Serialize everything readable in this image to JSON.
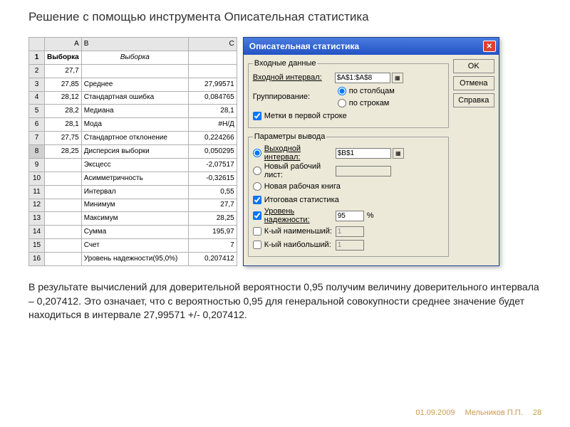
{
  "title": "Решение с помощью инструмента Описательная статистика",
  "sheet": {
    "cols": [
      "A",
      "B",
      "C"
    ],
    "rows": [
      {
        "n": "1",
        "a": "Выборка",
        "b": "Выборка",
        "c": ""
      },
      {
        "n": "2",
        "a": "27,7",
        "b": "",
        "c": ""
      },
      {
        "n": "3",
        "a": "27,85",
        "b": "Среднее",
        "c": "27,99571"
      },
      {
        "n": "4",
        "a": "28,12",
        "b": "Стандартная ошибка",
        "c": "0,084765"
      },
      {
        "n": "5",
        "a": "28,2",
        "b": "Медиана",
        "c": "28,1"
      },
      {
        "n": "6",
        "a": "28,1",
        "b": "Мода",
        "c": "#Н/Д"
      },
      {
        "n": "7",
        "a": "27,75",
        "b": "Стандартное отклонение",
        "c": "0,224266"
      },
      {
        "n": "8",
        "a": "28,25",
        "b": "Дисперсия выборки",
        "c": "0,050295"
      },
      {
        "n": "9",
        "a": "",
        "b": "Эксцесс",
        "c": "-2,07517"
      },
      {
        "n": "10",
        "a": "",
        "b": "Асимметричность",
        "c": "-0,32615"
      },
      {
        "n": "11",
        "a": "",
        "b": "Интервал",
        "c": "0,55"
      },
      {
        "n": "12",
        "a": "",
        "b": "Минимум",
        "c": "27,7"
      },
      {
        "n": "13",
        "a": "",
        "b": "Максимум",
        "c": "28,25"
      },
      {
        "n": "14",
        "a": "",
        "b": "Сумма",
        "c": "195,97"
      },
      {
        "n": "15",
        "a": "",
        "b": "Счет",
        "c": "7"
      },
      {
        "n": "16",
        "a": "",
        "b": "Уровень надежности(95,0%)",
        "c": "0,207412"
      }
    ]
  },
  "dialog": {
    "title": "Описательная статистика",
    "buttons": {
      "ok": "OK",
      "cancel": "Отмена",
      "help": "Справка"
    },
    "group1": {
      "legend": "Входные данные",
      "input_label": "Входной интервал:",
      "input_value": "$A$1:$A$8",
      "group_label": "Группирование:",
      "by_cols": "по столбцам",
      "by_rows": "по строкам",
      "labels_first": "Метки в первой строке"
    },
    "group2": {
      "legend": "Параметры вывода",
      "out_range": "Выходной интервал:",
      "out_value": "$B$1",
      "new_sheet": "Новый рабочий лист:",
      "new_book": "Новая рабочая книга",
      "summary": "Итоговая статистика",
      "conf": "Уровень надежности:",
      "conf_val": "95",
      "pct": "%",
      "kmin": "К-ый наименьший:",
      "kmin_val": "1",
      "kmax": "К-ый наибольший:",
      "kmax_val": "1"
    }
  },
  "description": "В результате вычислений для доверительной вероятности 0,95 получим величину доверительного интервала – 0,207412. Это означает, что с вероятностью 0,95 для генеральной совокупности среднее значение будет находиться в интервале 27,99571 +/- 0,207412.",
  "footer": {
    "date": "01.09.2009",
    "author": "Мельников П.П.",
    "page": "28"
  }
}
